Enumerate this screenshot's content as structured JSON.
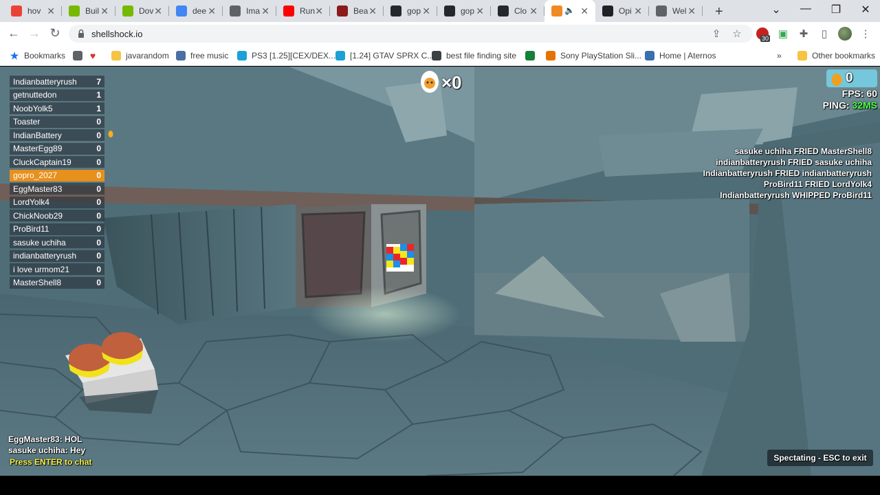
{
  "tabs": [
    {
      "title": "hov",
      "icon": "google-icon",
      "color": "#ea4335",
      "active": false
    },
    {
      "title": "Buil",
      "icon": "nvidia-icon",
      "color": "#76b900",
      "active": false
    },
    {
      "title": "Dov",
      "icon": "nvidia-icon",
      "color": "#76b900",
      "active": false
    },
    {
      "title": "dee",
      "icon": "google-g-icon",
      "color": "#4285f4",
      "active": false
    },
    {
      "title": "Ima",
      "icon": "chart-icon",
      "color": "#5f6368",
      "active": false
    },
    {
      "title": "Run",
      "icon": "youtube-icon",
      "color": "#ff0000",
      "active": false
    },
    {
      "title": "Bea",
      "icon": "medium-icon",
      "color": "#8b1a1a",
      "active": false
    },
    {
      "title": "gop",
      "icon": "github-icon",
      "color": "#24292e",
      "active": false
    },
    {
      "title": "gop",
      "icon": "github-icon",
      "color": "#24292e",
      "active": false
    },
    {
      "title": "Clo",
      "icon": "github-icon",
      "color": "#24292e",
      "active": false
    },
    {
      "title": "",
      "icon": "shellshock-icon",
      "color": "#f08a24",
      "active": true
    },
    {
      "title": "Opi",
      "icon": "openai-icon",
      "color": "#202124",
      "active": false
    },
    {
      "title": "Wel",
      "icon": "globe-icon",
      "color": "#5f6368",
      "active": false
    }
  ],
  "address": {
    "url": "shellshock.io"
  },
  "extension_badge": "30",
  "bookmarks": [
    {
      "label": "Bookmarks",
      "icon": "star-icon"
    },
    {
      "label": "",
      "icon": "globe-icon"
    },
    {
      "label": "",
      "icon": "heart-icon"
    },
    {
      "label": "javarandom",
      "icon": "folder-icon"
    },
    {
      "label": "free music",
      "icon": "headphones-icon"
    },
    {
      "label": "PS3 [1.25][CEX/DEX...",
      "icon": "c-icon"
    },
    {
      "label": "[1.24] GTAV SPRX C...",
      "icon": "c-icon"
    },
    {
      "label": "best file finding site",
      "icon": "printer-icon"
    },
    {
      "label": "",
      "icon": "image-icon"
    },
    {
      "label": "Sony PlayStation Sli...",
      "icon": "bag-icon"
    },
    {
      "label": "Home | Aternos",
      "icon": "aternos-icon"
    },
    {
      "label": "Other bookmarks",
      "icon": "folder-icon"
    }
  ],
  "overflow_label": "»",
  "scoreboard": [
    {
      "name": "Indianbatteryrush",
      "score": "7"
    },
    {
      "name": "getnuttedon",
      "score": "1"
    },
    {
      "name": "NoobYolk5",
      "score": "1"
    },
    {
      "name": "Toaster",
      "score": "0"
    },
    {
      "name": "IndianBattery",
      "score": "0"
    },
    {
      "name": "MasterEgg89",
      "score": "0"
    },
    {
      "name": "CluckCaptain19",
      "score": "0"
    },
    {
      "name": "gopro_2027",
      "score": "0",
      "highlight": true
    },
    {
      "name": "EggMaster83",
      "score": "0"
    },
    {
      "name": "LordYolk4",
      "score": "0"
    },
    {
      "name": "ChickNoob29",
      "score": "0"
    },
    {
      "name": "ProBird11",
      "score": "0"
    },
    {
      "name": "sasuke uchiha",
      "score": "0"
    },
    {
      "name": "indianbatteryrush",
      "score": "0"
    },
    {
      "name": "i love urmom21",
      "score": "0"
    },
    {
      "name": "MasterShell8",
      "score": "0"
    }
  ],
  "hud": {
    "kill_streak": "×0",
    "eggs": "0",
    "fps": "FPS: 60",
    "ping_label": "PING:",
    "ping_value": "32MS",
    "ping_color": "#4cff4c"
  },
  "killfeed": [
    "sasuke uchiha FRIED MasterShell8",
    "indianbatteryrush FRIED sasuke uchiha",
    "Indianbatteryrush FRIED indianbatteryrush",
    "ProBird11 FRIED LordYolk4",
    "Indianbatteryrush WHIPPED ProBird11"
  ],
  "chat": {
    "messages": [
      "EggMaster83: HOL",
      "sasuke uchiha: Hey"
    ],
    "prompt": "Press ENTER to chat",
    "prompt_color": "#f6f24a"
  },
  "spectate_label": "Spectating - ESC to exit"
}
